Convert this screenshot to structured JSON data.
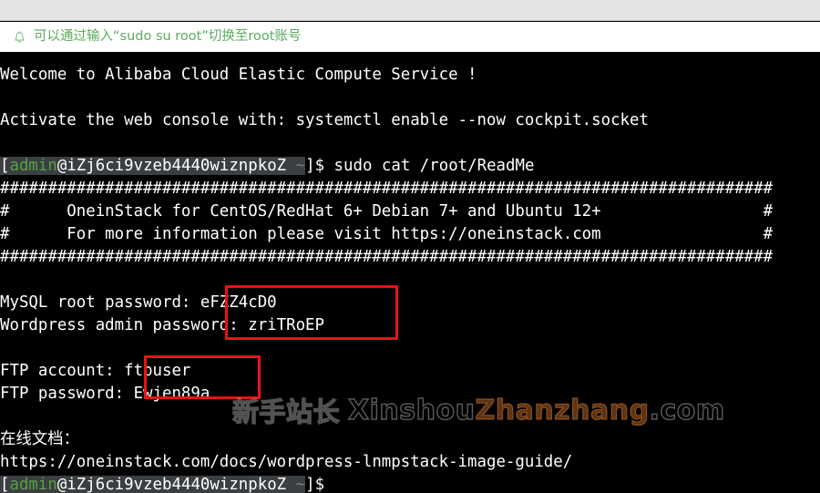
{
  "chrome": {
    "bar_label": ""
  },
  "notice": {
    "icon": "bell-icon",
    "text": "可以通过输入“sudo su root”切换至root账号",
    "color": "#5cab5c"
  },
  "terminal": {
    "background": "#000000",
    "foreground": "#ffffff",
    "prompt_user_color": "#57a143",
    "prompt_highlight_bg": "#3b3f42",
    "lines": [
      {
        "id": "line-welcome",
        "text": "Welcome to Alibaba Cloud Elastic Compute Service !"
      },
      {
        "id": "line-blank-1",
        "text": ""
      },
      {
        "id": "line-activate",
        "text": "Activate the web console with: systemctl enable --now cockpit.socket"
      },
      {
        "id": "line-blank-2",
        "text": ""
      },
      {
        "id": "line-prompt-1",
        "text": "[admin@iZj6ci9vzeb4440wiznpkoZ ~]$ sudo cat /root/ReadMe"
      },
      {
        "id": "line-hash-top",
        "text": "#################################################################################"
      },
      {
        "id": "line-banner-1",
        "text": "#      OneinStack for CentOS/RedHat 6+ Debian 7+ and Ubuntu 12+                 #"
      },
      {
        "id": "line-banner-2",
        "text": "#      For more information please visit https://oneinstack.com                 #"
      },
      {
        "id": "line-hash-bottom",
        "text": "#################################################################################"
      },
      {
        "id": "line-blank-3",
        "text": ""
      },
      {
        "id": "line-mysql",
        "text": "MySQL root password: eFZZ4cD0"
      },
      {
        "id": "line-wordpress",
        "text": "Wordpress admin password: zriTRoEP"
      },
      {
        "id": "line-blank-4",
        "text": ""
      },
      {
        "id": "line-ftp-account",
        "text": "FTP account: ftpuser"
      },
      {
        "id": "line-ftp-password",
        "text": "FTP password: Ewjen89a"
      },
      {
        "id": "line-blank-5",
        "text": ""
      },
      {
        "id": "line-docs-label",
        "text": "在线文档："
      },
      {
        "id": "line-docs-url",
        "text": "https://oneinstack.com/docs/wordpress-lnmpstack-image-guide/"
      },
      {
        "id": "line-prompt-2",
        "text": "[admin@iZj6ci9vzeb4440wiznpkoZ ~]$"
      }
    ],
    "prompt": {
      "bracket_open": "[",
      "user": "admin",
      "at": "@",
      "host": "iZj6ci9vzeb4440wiznpkoZ",
      "cwd": "~",
      "bracket_close": "]",
      "sigil": "$",
      "command_1": " sudo cat /root/ReadMe",
      "command_2": ""
    },
    "credentials": {
      "mysql_root_label": "MySQL root password:",
      "mysql_root_value": "eFZZ4cD0",
      "wordpress_admin_label": "Wordpress admin password:",
      "wordpress_admin_value": "zriTRoEP",
      "ftp_account_label": "FTP account:",
      "ftp_account_value": "ftpuser",
      "ftp_password_label": "FTP password:",
      "ftp_password_value": "Ewjen89a"
    },
    "docs": {
      "label": "在线文档：",
      "url": "https://oneinstack.com/docs/wordpress-lnmpstack-image-guide/"
    }
  },
  "annotations": {
    "color": "#ee1111",
    "boxes": [
      {
        "id": "redbox-credentials",
        "covers": "eFZZ4cD0 / zriTRoEP"
      },
      {
        "id": "redbox-ftp",
        "covers": "ftpuser / Ewjen89a"
      }
    ]
  },
  "watermark": {
    "cn": "新手站长",
    "part_a": "Xinshou",
    "part_b": "Zhanzhang",
    "part_c": ".com"
  }
}
